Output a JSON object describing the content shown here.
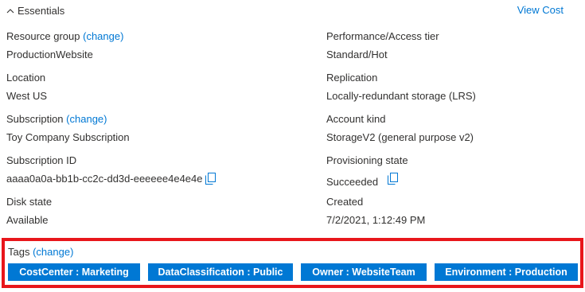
{
  "header": {
    "essentials_label": "Essentials",
    "view_cost_label": "View Cost"
  },
  "fields": {
    "resource_group": {
      "label": "Resource group",
      "change": "(change)",
      "value": "ProductionWebsite"
    },
    "location": {
      "label": "Location",
      "value": "West US"
    },
    "subscription": {
      "label": "Subscription",
      "change": "(change)",
      "value": "Toy Company Subscription"
    },
    "subscription_id": {
      "label": "Subscription ID",
      "value": "aaaa0a0a-bb1b-cc2c-dd3d-eeeeee4e4e4e"
    },
    "disk_state": {
      "label": "Disk state",
      "value": "Available"
    },
    "performance_tier": {
      "label": "Performance/Access tier",
      "value": "Standard/Hot"
    },
    "replication": {
      "label": "Replication",
      "value": "Locally-redundant storage (LRS)"
    },
    "account_kind": {
      "label": "Account kind",
      "value": "StorageV2 (general purpose v2)"
    },
    "provisioning_state": {
      "label": "Provisioning state",
      "value": "Succeeded"
    },
    "created": {
      "label": "Created",
      "value": "7/2/2021, 1:12:49 PM"
    }
  },
  "tags": {
    "label": "Tags",
    "change": "(change)",
    "items": [
      "CostCenter : Marketing",
      "DataClassification : Public",
      "Owner : WebsiteTeam",
      "Environment : Production"
    ]
  },
  "colors": {
    "link": "#0078d4",
    "tag_bg": "#0078d4",
    "highlight_border": "#e8161b"
  },
  "icons": [
    "chevron-up-icon",
    "copy-icon"
  ]
}
